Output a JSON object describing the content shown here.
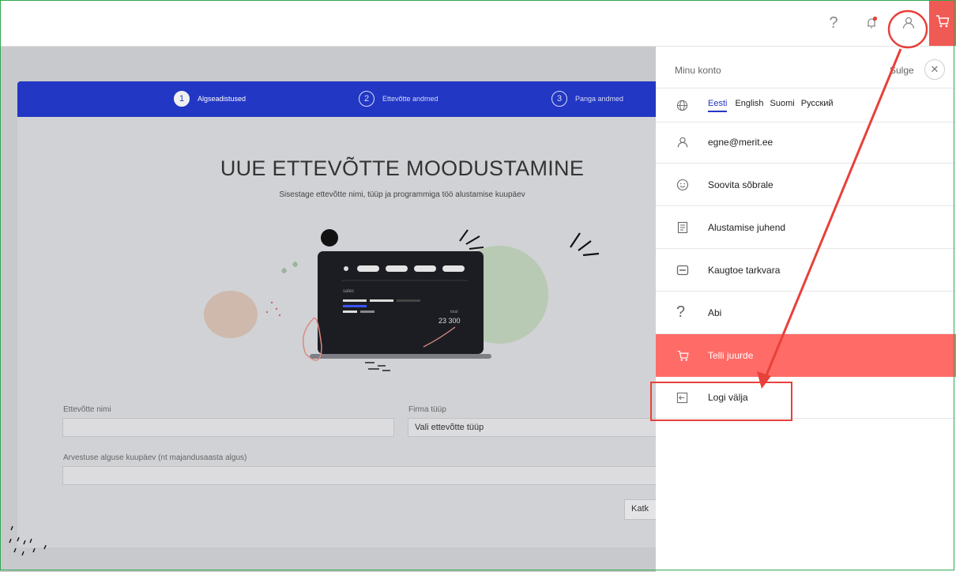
{
  "topbar": {
    "help_icon": "question-icon",
    "bell_icon": "bell-icon",
    "user_icon": "user-icon",
    "cart_icon": "cart-icon",
    "accent": "#f05a55"
  },
  "wizard": {
    "steps": [
      {
        "num": "1",
        "label": "Algseadistused"
      },
      {
        "num": "2",
        "label": "Ettevõtte andmed"
      },
      {
        "num": "3",
        "label": "Panga andmed"
      }
    ],
    "title": "UUE ETTEVÕTTE MOODUSTAMINE",
    "subtitle": "Sisestage ettevõtte nimi, tüüp ja programmiga töö alustamise kuupäev",
    "illustration": {
      "label": "sales",
      "total_label": "total",
      "total_value": "23 300"
    },
    "company_name_label": "Ettevõtte nimi",
    "company_type_label": "Firma tüüp",
    "company_type_placeholder": "Vali ettevõtte tüüp",
    "start_date_label": "Arvestuse alguse kuupäev (nt majandusaasta algus)",
    "cancel_label": "Katk"
  },
  "panel": {
    "title": "Minu konto",
    "close_label": "Sulge",
    "languages": [
      "Eesti",
      "English",
      "Suomi",
      "Русский"
    ],
    "active_language": "Eesti",
    "items": [
      {
        "label": "egne@merit.ee",
        "icon": "user-icon"
      },
      {
        "label": "Soovita sõbrale",
        "icon": "smiley-icon"
      },
      {
        "label": "Alustamise juhend",
        "icon": "document-icon"
      },
      {
        "label": "Kaugtoe tarkvara",
        "icon": "remote-icon"
      },
      {
        "label": "Abi",
        "icon": "question-icon"
      },
      {
        "label": "Telli juurde",
        "icon": "cart-icon"
      },
      {
        "label": "Logi välja",
        "icon": "logout-icon"
      }
    ],
    "highlight_color": "#ff6b67"
  },
  "annotation_color": "#e8403a"
}
